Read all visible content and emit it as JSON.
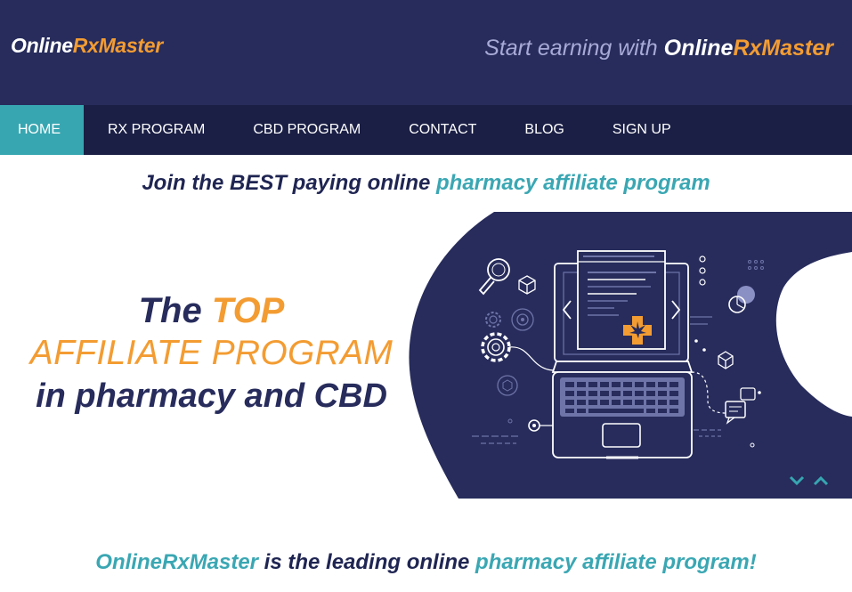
{
  "header": {
    "logo": {
      "part1": "Online",
      "part2": "Rx",
      "part3": "Master"
    },
    "tagline": {
      "prefix": "Start earning with ",
      "brand1": "Online",
      "brand2": "Rx",
      "brand3": "Master"
    }
  },
  "nav": {
    "items": [
      {
        "label": "HOME",
        "active": true
      },
      {
        "label": "RX PROGRAM"
      },
      {
        "label": "CBD PROGRAM"
      },
      {
        "label": "CONTACT"
      },
      {
        "label": "BLOG"
      },
      {
        "label": "SIGN UP"
      }
    ]
  },
  "banner": {
    "join_prefix": "Join the BEST paying online ",
    "join_highlight": "pharmacy affiliate program"
  },
  "hero": {
    "line1_prefix": "The ",
    "line1_highlight": "TOP",
    "line2": "AFFILIATE PROGRAM",
    "line3": "in pharmacy and CBD"
  },
  "bottom": {
    "brand": "OnlineRxMaster",
    "middle": " is the leading online ",
    "highlight": "pharmacy affiliate program!"
  },
  "icons": {
    "illustration": "laptop-pharmacy-illustration",
    "cannabis": "cannabis-leaf-icon",
    "slider_down": "chevron-down-icon",
    "slider_up": "chevron-up-icon"
  },
  "colors": {
    "header_bg": "#272c5c",
    "nav_bg": "#1b1f45",
    "accent_teal": "#37a6b1",
    "accent_orange": "#f39c32",
    "text_dark": "#1f2552"
  }
}
